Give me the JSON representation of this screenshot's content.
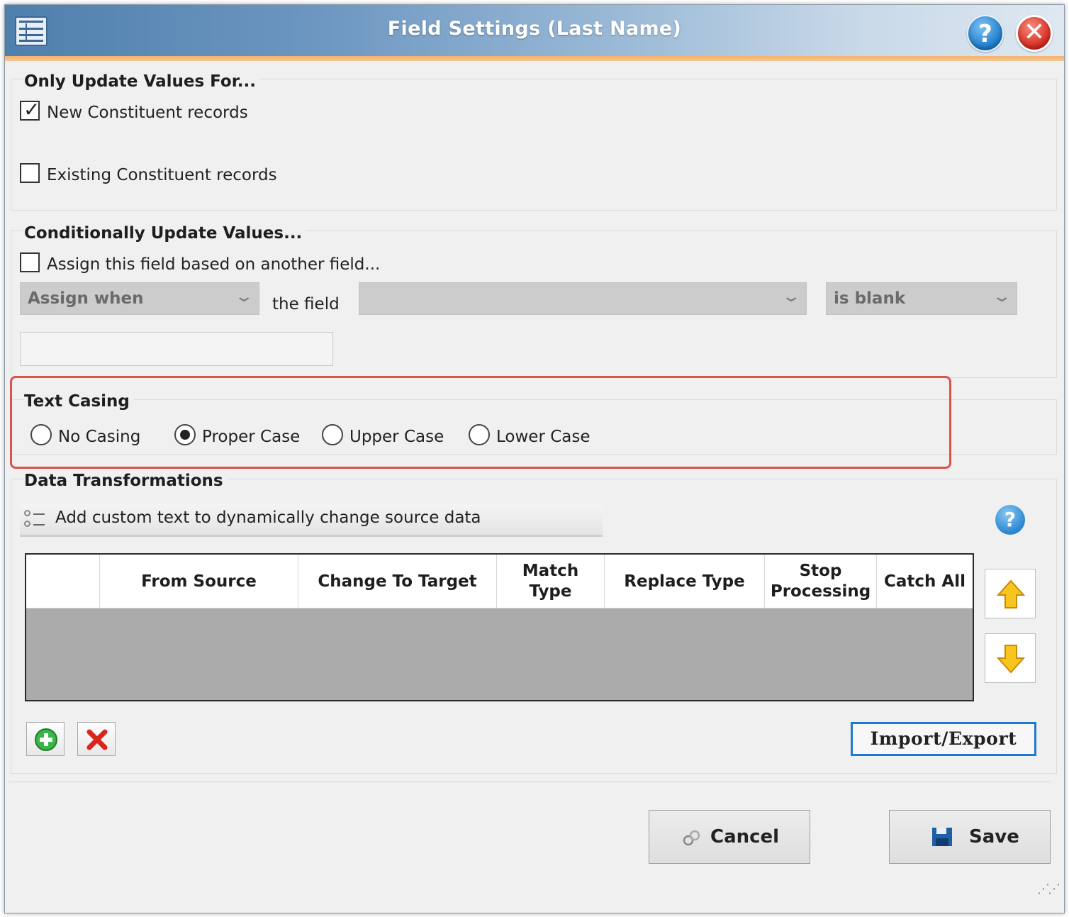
{
  "window": {
    "title": "Field Settings (Last Name)"
  },
  "only_update": {
    "title": "Only Update Values For...",
    "new_records": {
      "label": "New Constituent records",
      "checked": true
    },
    "existing_records": {
      "label": "Existing Constituent records",
      "checked": false
    }
  },
  "conditional": {
    "title": "Conditionally Update Values...",
    "assign_checkbox": {
      "label": "Assign this field based on another field...",
      "checked": false
    },
    "assign_when": "Assign when",
    "the_field_label": "the field",
    "field_select": "",
    "condition_select": "is blank",
    "value_input": ""
  },
  "text_casing": {
    "title": "Text Casing",
    "options": [
      {
        "label": "No Casing",
        "selected": false
      },
      {
        "label": "Proper Case",
        "selected": true
      },
      {
        "label": "Upper Case",
        "selected": false
      },
      {
        "label": "Lower Case",
        "selected": false
      }
    ]
  },
  "data_transformations": {
    "title": "Data Transformations",
    "add_custom_text": "Add custom text to dynamically change source data",
    "columns": [
      "",
      "From Source",
      "Change To Target",
      "Match Type",
      "Replace Type",
      "Stop Processing",
      "Catch All"
    ],
    "import_export": "Import/Export"
  },
  "footer": {
    "cancel": "Cancel",
    "save": "Save"
  },
  "colors": {
    "highlight": "#d9534f",
    "accent_blue": "#1f78d1",
    "grid_empty": "#ababab"
  }
}
